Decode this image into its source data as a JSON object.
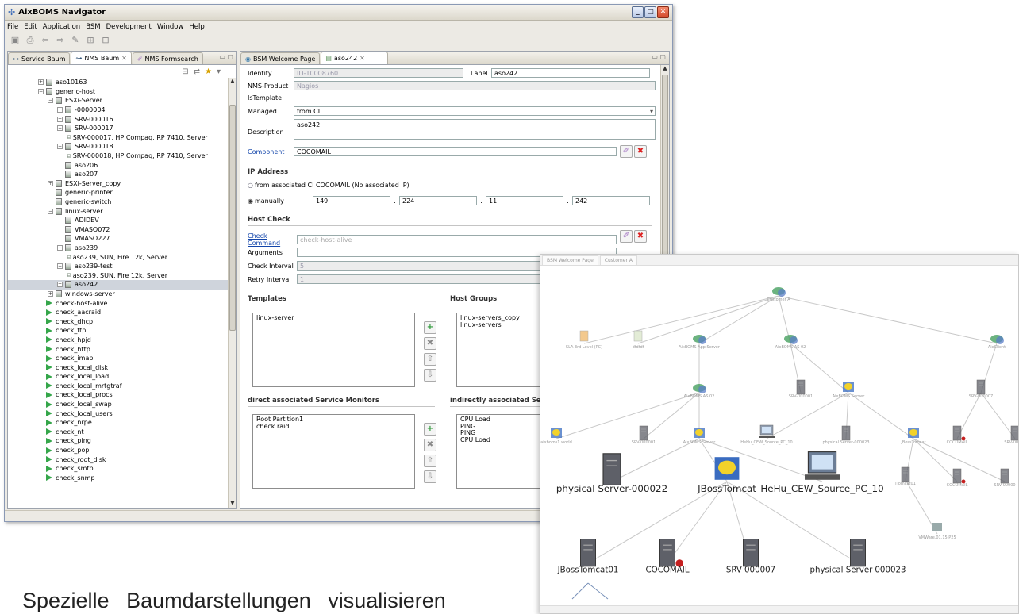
{
  "app": {
    "title": "AixBOMS Navigator"
  },
  "menu": [
    "File",
    "Edit",
    "Application",
    "BSM",
    "Development",
    "Window",
    "Help"
  ],
  "left_tabs": [
    {
      "label": "Service Baum"
    },
    {
      "label": "NMS Baum"
    },
    {
      "label": "NMS Formsearch"
    }
  ],
  "tree": [
    {
      "d": 3,
      "ex": "+",
      "ic": "host",
      "t": "aso10163"
    },
    {
      "d": 3,
      "ex": "-",
      "ic": "host",
      "t": "generic-host"
    },
    {
      "d": 4,
      "ex": "-",
      "ic": "host",
      "t": "ESXi-Server"
    },
    {
      "d": 5,
      "ex": "+",
      "ic": "host",
      "t": "-0000004"
    },
    {
      "d": 5,
      "ex": "+",
      "ic": "host",
      "t": "SRV-000016"
    },
    {
      "d": 5,
      "ex": "-",
      "ic": "host",
      "t": "SRV-000017"
    },
    {
      "d": 6,
      "ex": "",
      "ic": "link",
      "t": "SRV-000017, HP Compaq, RP 7410, Server"
    },
    {
      "d": 5,
      "ex": "-",
      "ic": "host",
      "t": "SRV-000018"
    },
    {
      "d": 6,
      "ex": "",
      "ic": "link",
      "t": "SRV-000018, HP Compaq, RP 7410, Server"
    },
    {
      "d": 5,
      "ex": "",
      "ic": "host",
      "t": "aso206"
    },
    {
      "d": 5,
      "ex": "",
      "ic": "host",
      "t": "aso207"
    },
    {
      "d": 4,
      "ex": "+",
      "ic": "host",
      "t": "ESXi-Server_copy"
    },
    {
      "d": 4,
      "ex": "",
      "ic": "host",
      "t": "generic-printer"
    },
    {
      "d": 4,
      "ex": "",
      "ic": "host",
      "t": "generic-switch"
    },
    {
      "d": 4,
      "ex": "-",
      "ic": "host",
      "t": "linux-server"
    },
    {
      "d": 5,
      "ex": "",
      "ic": "host",
      "t": "ADIDEV"
    },
    {
      "d": 5,
      "ex": "",
      "ic": "host",
      "t": "VMASO072"
    },
    {
      "d": 5,
      "ex": "",
      "ic": "host",
      "t": "VMASO227"
    },
    {
      "d": 5,
      "ex": "-",
      "ic": "host",
      "t": "aso239"
    },
    {
      "d": 6,
      "ex": "",
      "ic": "link",
      "t": "aso239, SUN, Fire 12k, Server"
    },
    {
      "d": 5,
      "ex": "-",
      "ic": "host",
      "t": "aso239-test"
    },
    {
      "d": 6,
      "ex": "",
      "ic": "link",
      "t": "aso239, SUN, Fire 12k, Server"
    },
    {
      "d": 5,
      "ex": "+",
      "ic": "host",
      "t": "aso242",
      "sel": true
    },
    {
      "d": 4,
      "ex": "+",
      "ic": "host",
      "t": "windows-server"
    },
    {
      "d": 3,
      "ex": "",
      "ic": "check",
      "t": "check-host-alive"
    },
    {
      "d": 3,
      "ex": "",
      "ic": "check",
      "t": "check_aacraid"
    },
    {
      "d": 3,
      "ex": "",
      "ic": "check",
      "t": "check_dhcp"
    },
    {
      "d": 3,
      "ex": "",
      "ic": "check",
      "t": "check_ftp"
    },
    {
      "d": 3,
      "ex": "",
      "ic": "check",
      "t": "check_hpjd"
    },
    {
      "d": 3,
      "ex": "",
      "ic": "check",
      "t": "check_http"
    },
    {
      "d": 3,
      "ex": "",
      "ic": "check",
      "t": "check_imap"
    },
    {
      "d": 3,
      "ex": "",
      "ic": "check",
      "t": "check_local_disk"
    },
    {
      "d": 3,
      "ex": "",
      "ic": "check",
      "t": "check_local_load"
    },
    {
      "d": 3,
      "ex": "",
      "ic": "check",
      "t": "check_local_mrtgtraf"
    },
    {
      "d": 3,
      "ex": "",
      "ic": "check",
      "t": "check_local_procs"
    },
    {
      "d": 3,
      "ex": "",
      "ic": "check",
      "t": "check_local_swap"
    },
    {
      "d": 3,
      "ex": "",
      "ic": "check",
      "t": "check_local_users"
    },
    {
      "d": 3,
      "ex": "",
      "ic": "check",
      "t": "check_nrpe"
    },
    {
      "d": 3,
      "ex": "",
      "ic": "check",
      "t": "check_nt"
    },
    {
      "d": 3,
      "ex": "",
      "ic": "check",
      "t": "check_ping"
    },
    {
      "d": 3,
      "ex": "",
      "ic": "check",
      "t": "check_pop"
    },
    {
      "d": 3,
      "ex": "",
      "ic": "check",
      "t": "check_root_disk"
    },
    {
      "d": 3,
      "ex": "",
      "ic": "check",
      "t": "check_smtp"
    },
    {
      "d": 3,
      "ex": "",
      "ic": "check",
      "t": "check_snmp"
    }
  ],
  "right_tabs": [
    {
      "label": "BSM Welcome Page"
    },
    {
      "label": "aso242"
    }
  ],
  "form": {
    "identity_label": "Identity",
    "identity_value": "ID-10008760",
    "label_label": "Label",
    "label_value": "aso242",
    "nms_product_label": "NMS-Product",
    "nms_product_value": "Nagios",
    "is_template_label": "IsTemplate",
    "managed_label": "Managed",
    "managed_value": "from CI",
    "description_label": "Description",
    "description_value": "aso242",
    "component_label": "Component",
    "component_value": "COCOMAIL"
  },
  "ip": {
    "section": "IP Address",
    "from_ci_text": "from associated CI  COCOMAIL (No associated IP)",
    "manual_label": "manually",
    "octets": [
      "149",
      "224",
      "11",
      "242"
    ]
  },
  "host_check": {
    "section": "Host Check",
    "check_command_label": "Check Command",
    "check_command_value": "check-host-alive",
    "arguments_label": "Arguments",
    "check_interval_label": "Check Interval",
    "check_interval_value": "5",
    "retry_interval_label": "Retry Interval",
    "retry_interval_value": "1"
  },
  "templates": {
    "title": "Templates",
    "items": [
      "linux-server"
    ]
  },
  "host_groups": {
    "title": "Host Groups",
    "items": [
      "linux-servers_copy",
      "linux-servers"
    ]
  },
  "direct_monitors": {
    "title": "direct associated Service Monitors",
    "items": [
      "Root Partition1",
      "check raid"
    ]
  },
  "indirect_monitors": {
    "title": "indirectly associated Servi",
    "items": [
      "CPU Load",
      "PING",
      "PING",
      "CPU Load"
    ]
  },
  "overlay": {
    "tabs": [
      "BSM Welcome Page",
      "Customer A"
    ]
  },
  "graph_nodes": [
    {
      "label": "Customer A",
      "icon": "cluster"
    },
    {
      "label": "SLA 3rd Level (PC)",
      "icon": "doc"
    },
    {
      "label": "dfdfdf",
      "icon": "doc"
    },
    {
      "label": "AixBOMS App Server",
      "icon": "cluster"
    },
    {
      "label": "AixBOMS AS 02",
      "icon": "cluster"
    },
    {
      "label": "AixClient",
      "icon": "cluster"
    },
    {
      "label": "AixBOMS AS 02",
      "icon": "cluster"
    },
    {
      "label": "SRV-000001",
      "icon": "server"
    },
    {
      "label": "AixBOMS Server",
      "icon": "app"
    },
    {
      "label": "SRV-000007",
      "icon": "server"
    },
    {
      "label": "aixboms1.world",
      "icon": "app"
    },
    {
      "label": "SRV-000001",
      "icon": "server"
    },
    {
      "label": "AixBOMS Server",
      "icon": "app"
    },
    {
      "label": "HeHu_CEW_Source_PC_10",
      "icon": "pc"
    },
    {
      "label": "physical Server-000023",
      "icon": "server"
    },
    {
      "label": "JBossTomcat",
      "icon": "app"
    },
    {
      "label": "COCOMAIL",
      "icon": "server"
    },
    {
      "label": "SRV-00000",
      "icon": "server"
    },
    {
      "label": "physical Server-000022",
      "icon": "server"
    },
    {
      "label": "JBossTomcat",
      "icon": "app"
    },
    {
      "label": "HeHu_CEW_Source_PC_10",
      "icon": "pc"
    },
    {
      "label": "JTomcat01",
      "icon": "server"
    },
    {
      "label": "COCOMAIL",
      "icon": "server"
    },
    {
      "label": "SRV-00000",
      "icon": "server"
    },
    {
      "label": "VMWare.01.15.P25",
      "icon": "vm"
    },
    {
      "label": "JBossTomcat01",
      "icon": "server"
    },
    {
      "label": "COCOMAIL",
      "icon": "server"
    },
    {
      "label": "SRV-000007",
      "icon": "server"
    },
    {
      "label": "physical Server-000023",
      "icon": "server"
    }
  ],
  "caption": "Spezielle Baumdarstellungen visualisieren"
}
